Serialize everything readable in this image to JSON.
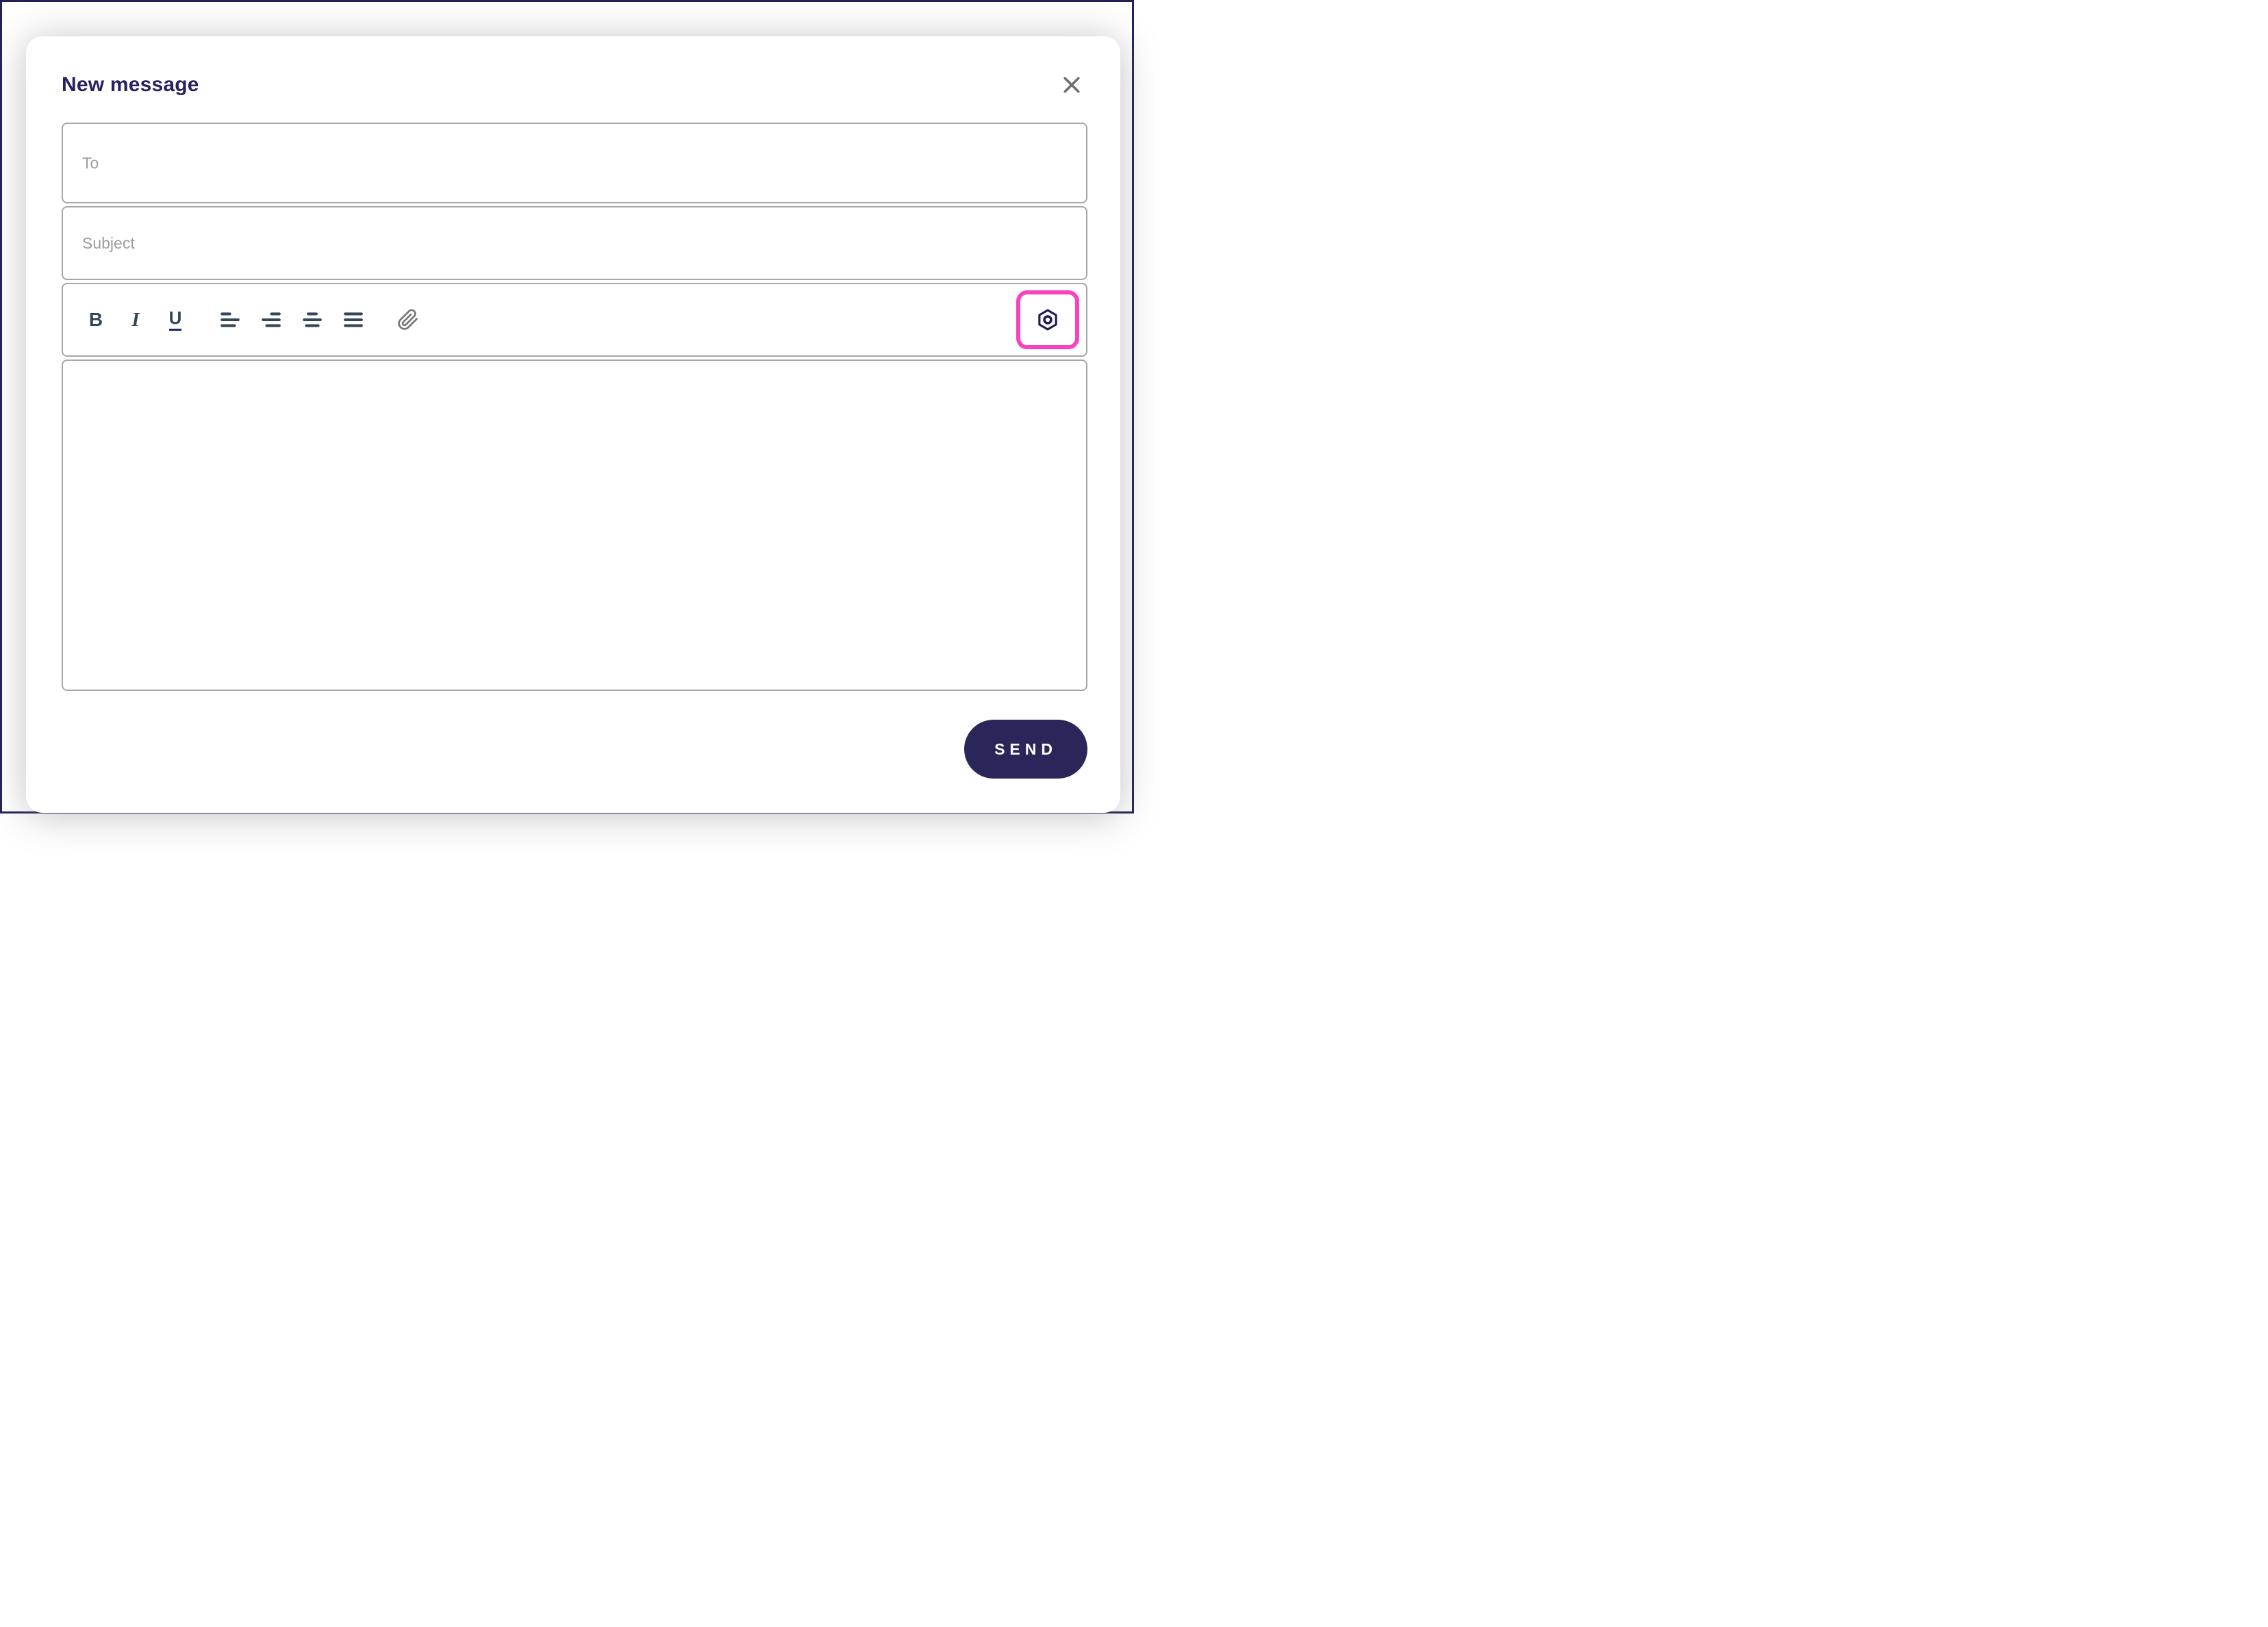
{
  "modal": {
    "title": "New message"
  },
  "fields": {
    "to": {
      "placeholder": "To",
      "value": ""
    },
    "subject": {
      "placeholder": "Subject",
      "value": ""
    },
    "message": {
      "value": ""
    }
  },
  "toolbar": {
    "bold_label": "B",
    "italic_label": "I",
    "underline_label": "U",
    "align_icons": [
      "align-left-icon",
      "align-right-icon",
      "align-center-icon",
      "align-justify-icon"
    ],
    "attach_icon": "paperclip-icon",
    "settings_icon": "hexagon-nut-icon",
    "settings_highlighted": true
  },
  "actions": {
    "send_label": "SEND"
  },
  "icons": {
    "close": "x-icon"
  },
  "colors": {
    "window_border": "#232258",
    "title_navy": "#262262",
    "field_border": "#A7A7A7",
    "placeholder_gray": "#9D9D9D",
    "toolbar_icon": "#35455C",
    "close_gray": "#6F6F6F",
    "attach_gray": "#757575",
    "highlight_pink": "#F743BD",
    "gear_navy": "#211C54",
    "send_bg": "#2B2659",
    "send_text": "#FFFFFF"
  }
}
